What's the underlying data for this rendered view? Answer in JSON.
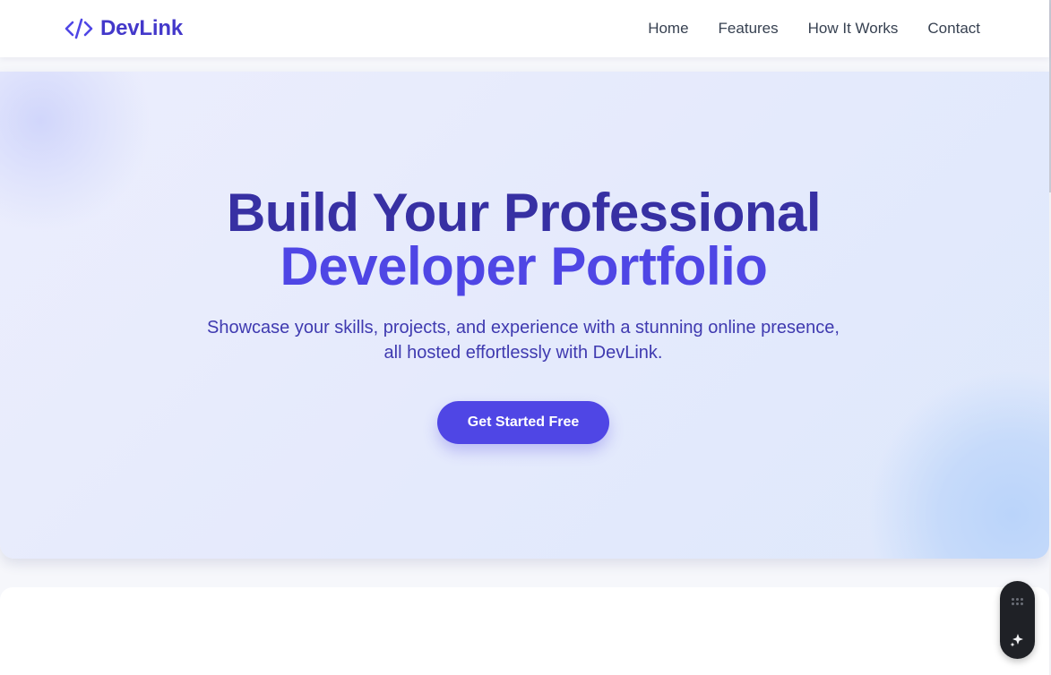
{
  "header": {
    "brand": "DevLink",
    "nav": [
      {
        "label": "Home"
      },
      {
        "label": "Features"
      },
      {
        "label": "How It Works"
      },
      {
        "label": "Contact"
      }
    ]
  },
  "hero": {
    "title_line1": "Build Your Professional",
    "title_line2": "Developer Portfolio",
    "subtitle_line1": "Showcase your skills, projects, and experience with a stunning online presence,",
    "subtitle_line2": "all hosted effortlessly with DevLink.",
    "cta_label": "Get Started Free"
  },
  "icons": {
    "brand": "code-brackets-icon",
    "widget_top": "drag-grip-icon",
    "widget_bottom": "sparkle-icon"
  },
  "colors": {
    "brand": "#4338ca",
    "title_dark": "#3730a3",
    "title_accent": "#4f46e5",
    "cta": "#4f46e5",
    "nav_text": "#374151"
  }
}
